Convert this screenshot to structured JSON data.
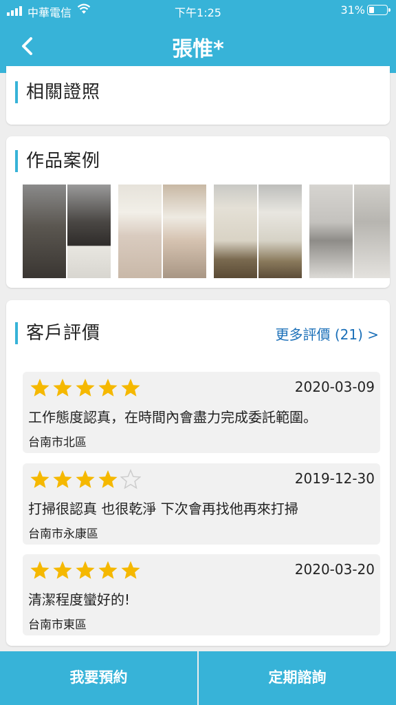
{
  "status_bar": {
    "carrier": "中華電信",
    "time": "下午1:25",
    "battery": "31%",
    "battery_level": 0.31
  },
  "header": {
    "title": "張惟*",
    "back_icon": "chevron-left-icon"
  },
  "sections": {
    "certificates": {
      "title": "相關證照"
    },
    "portfolio": {
      "title": "作品案例"
    },
    "reviews": {
      "title": "客戶評價",
      "more_link": "更多評價 (21) >",
      "items": [
        {
          "rating": 5,
          "date": "2020-03-09",
          "text": "工作態度認真，在時間內會盡力完成委託範圍。",
          "location": "台南市北區"
        },
        {
          "rating": 4,
          "date": "2019-12-30",
          "text": "打掃很認真 也很乾淨 下次會再找他再來打掃",
          "location": "台南市永康區"
        },
        {
          "rating": 5,
          "date": "2020-03-20",
          "text": "清潔程度蠻好的!",
          "location": "台南市東區"
        }
      ]
    }
  },
  "footer": {
    "book_label": "我要預約",
    "consult_label": "定期諮詢"
  },
  "colors": {
    "accent": "#37b3d8",
    "link": "#1a6fb8",
    "star": "#f5b800",
    "star_empty": "#cccccc"
  }
}
